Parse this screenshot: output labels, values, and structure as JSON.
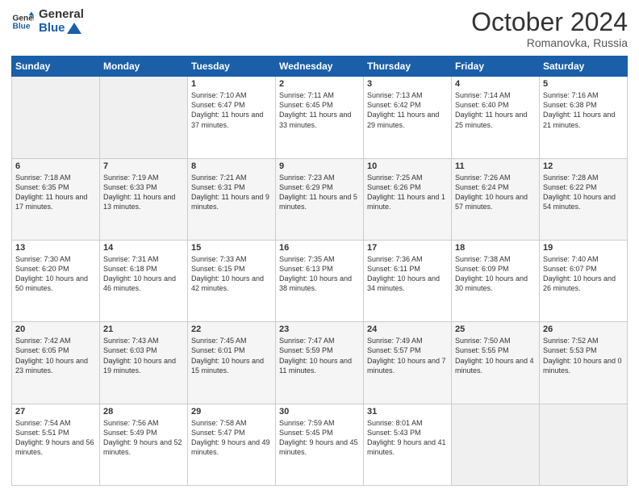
{
  "header": {
    "logo_line1": "General",
    "logo_line2": "Blue",
    "month": "October 2024",
    "location": "Romanovka, Russia"
  },
  "days_of_week": [
    "Sunday",
    "Monday",
    "Tuesday",
    "Wednesday",
    "Thursday",
    "Friday",
    "Saturday"
  ],
  "weeks": [
    [
      {
        "day": "",
        "sunrise": "",
        "sunset": "",
        "daylight": "",
        "empty": true
      },
      {
        "day": "",
        "sunrise": "",
        "sunset": "",
        "daylight": "",
        "empty": true
      },
      {
        "day": "1",
        "sunrise": "Sunrise: 7:10 AM",
        "sunset": "Sunset: 6:47 PM",
        "daylight": "Daylight: 11 hours and 37 minutes."
      },
      {
        "day": "2",
        "sunrise": "Sunrise: 7:11 AM",
        "sunset": "Sunset: 6:45 PM",
        "daylight": "Daylight: 11 hours and 33 minutes."
      },
      {
        "day": "3",
        "sunrise": "Sunrise: 7:13 AM",
        "sunset": "Sunset: 6:42 PM",
        "daylight": "Daylight: 11 hours and 29 minutes."
      },
      {
        "day": "4",
        "sunrise": "Sunrise: 7:14 AM",
        "sunset": "Sunset: 6:40 PM",
        "daylight": "Daylight: 11 hours and 25 minutes."
      },
      {
        "day": "5",
        "sunrise": "Sunrise: 7:16 AM",
        "sunset": "Sunset: 6:38 PM",
        "daylight": "Daylight: 11 hours and 21 minutes."
      }
    ],
    [
      {
        "day": "6",
        "sunrise": "Sunrise: 7:18 AM",
        "sunset": "Sunset: 6:35 PM",
        "daylight": "Daylight: 11 hours and 17 minutes."
      },
      {
        "day": "7",
        "sunrise": "Sunrise: 7:19 AM",
        "sunset": "Sunset: 6:33 PM",
        "daylight": "Daylight: 11 hours and 13 minutes."
      },
      {
        "day": "8",
        "sunrise": "Sunrise: 7:21 AM",
        "sunset": "Sunset: 6:31 PM",
        "daylight": "Daylight: 11 hours and 9 minutes."
      },
      {
        "day": "9",
        "sunrise": "Sunrise: 7:23 AM",
        "sunset": "Sunset: 6:29 PM",
        "daylight": "Daylight: 11 hours and 5 minutes."
      },
      {
        "day": "10",
        "sunrise": "Sunrise: 7:25 AM",
        "sunset": "Sunset: 6:26 PM",
        "daylight": "Daylight: 11 hours and 1 minute."
      },
      {
        "day": "11",
        "sunrise": "Sunrise: 7:26 AM",
        "sunset": "Sunset: 6:24 PM",
        "daylight": "Daylight: 10 hours and 57 minutes."
      },
      {
        "day": "12",
        "sunrise": "Sunrise: 7:28 AM",
        "sunset": "Sunset: 6:22 PM",
        "daylight": "Daylight: 10 hours and 54 minutes."
      }
    ],
    [
      {
        "day": "13",
        "sunrise": "Sunrise: 7:30 AM",
        "sunset": "Sunset: 6:20 PM",
        "daylight": "Daylight: 10 hours and 50 minutes."
      },
      {
        "day": "14",
        "sunrise": "Sunrise: 7:31 AM",
        "sunset": "Sunset: 6:18 PM",
        "daylight": "Daylight: 10 hours and 46 minutes."
      },
      {
        "day": "15",
        "sunrise": "Sunrise: 7:33 AM",
        "sunset": "Sunset: 6:15 PM",
        "daylight": "Daylight: 10 hours and 42 minutes."
      },
      {
        "day": "16",
        "sunrise": "Sunrise: 7:35 AM",
        "sunset": "Sunset: 6:13 PM",
        "daylight": "Daylight: 10 hours and 38 minutes."
      },
      {
        "day": "17",
        "sunrise": "Sunrise: 7:36 AM",
        "sunset": "Sunset: 6:11 PM",
        "daylight": "Daylight: 10 hours and 34 minutes."
      },
      {
        "day": "18",
        "sunrise": "Sunrise: 7:38 AM",
        "sunset": "Sunset: 6:09 PM",
        "daylight": "Daylight: 10 hours and 30 minutes."
      },
      {
        "day": "19",
        "sunrise": "Sunrise: 7:40 AM",
        "sunset": "Sunset: 6:07 PM",
        "daylight": "Daylight: 10 hours and 26 minutes."
      }
    ],
    [
      {
        "day": "20",
        "sunrise": "Sunrise: 7:42 AM",
        "sunset": "Sunset: 6:05 PM",
        "daylight": "Daylight: 10 hours and 23 minutes."
      },
      {
        "day": "21",
        "sunrise": "Sunrise: 7:43 AM",
        "sunset": "Sunset: 6:03 PM",
        "daylight": "Daylight: 10 hours and 19 minutes."
      },
      {
        "day": "22",
        "sunrise": "Sunrise: 7:45 AM",
        "sunset": "Sunset: 6:01 PM",
        "daylight": "Daylight: 10 hours and 15 minutes."
      },
      {
        "day": "23",
        "sunrise": "Sunrise: 7:47 AM",
        "sunset": "Sunset: 5:59 PM",
        "daylight": "Daylight: 10 hours and 11 minutes."
      },
      {
        "day": "24",
        "sunrise": "Sunrise: 7:49 AM",
        "sunset": "Sunset: 5:57 PM",
        "daylight": "Daylight: 10 hours and 7 minutes."
      },
      {
        "day": "25",
        "sunrise": "Sunrise: 7:50 AM",
        "sunset": "Sunset: 5:55 PM",
        "daylight": "Daylight: 10 hours and 4 minutes."
      },
      {
        "day": "26",
        "sunrise": "Sunrise: 7:52 AM",
        "sunset": "Sunset: 5:53 PM",
        "daylight": "Daylight: 10 hours and 0 minutes."
      }
    ],
    [
      {
        "day": "27",
        "sunrise": "Sunrise: 7:54 AM",
        "sunset": "Sunset: 5:51 PM",
        "daylight": "Daylight: 9 hours and 56 minutes."
      },
      {
        "day": "28",
        "sunrise": "Sunrise: 7:56 AM",
        "sunset": "Sunset: 5:49 PM",
        "daylight": "Daylight: 9 hours and 52 minutes."
      },
      {
        "day": "29",
        "sunrise": "Sunrise: 7:58 AM",
        "sunset": "Sunset: 5:47 PM",
        "daylight": "Daylight: 9 hours and 49 minutes."
      },
      {
        "day": "30",
        "sunrise": "Sunrise: 7:59 AM",
        "sunset": "Sunset: 5:45 PM",
        "daylight": "Daylight: 9 hours and 45 minutes."
      },
      {
        "day": "31",
        "sunrise": "Sunrise: 8:01 AM",
        "sunset": "Sunset: 5:43 PM",
        "daylight": "Daylight: 9 hours and 41 minutes."
      },
      {
        "day": "",
        "sunrise": "",
        "sunset": "",
        "daylight": "",
        "empty": true
      },
      {
        "day": "",
        "sunrise": "",
        "sunset": "",
        "daylight": "",
        "empty": true
      }
    ]
  ]
}
